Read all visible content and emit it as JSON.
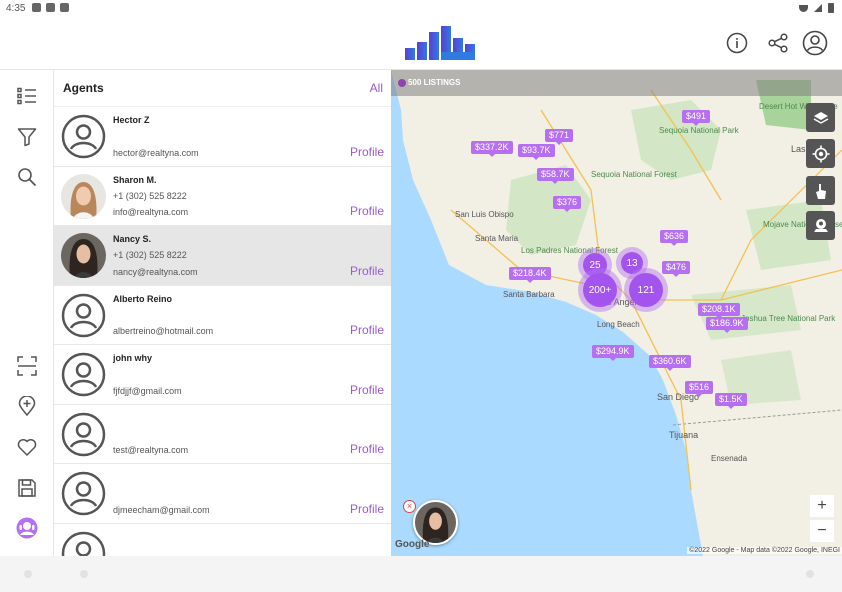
{
  "status_bar": {
    "time": "4:35"
  },
  "header": {
    "logo_icon": "bar-chart-logo",
    "buttons": [
      "info-icon",
      "share-icon",
      "account-icon"
    ]
  },
  "rail": {
    "top": [
      "list-icon",
      "filter-icon",
      "search-icon"
    ],
    "bottom": [
      "scan-icon",
      "add-location-icon",
      "heart-icon",
      "save-icon",
      "agent-icon"
    ]
  },
  "agents_panel": {
    "title": "Agents",
    "all_label": "All",
    "agents": [
      {
        "name": "Hector Z",
        "phone": "",
        "email": "hector@realtyna.com",
        "profile": "Profile",
        "photo": false,
        "selected": false
      },
      {
        "name": "Sharon M.",
        "phone": "+1 (302) 525 8222",
        "email": "info@realtyna.com",
        "profile": "Profile",
        "photo": true,
        "selected": false
      },
      {
        "name": "Nancy S.",
        "phone": "+1 (302) 525 8222",
        "email": "nancy@realtyna.com",
        "profile": "Profile",
        "photo": true,
        "selected": true
      },
      {
        "name": "Alberto Reino",
        "phone": "",
        "email": "albertreino@hotmail.com",
        "profile": "Profile",
        "photo": false,
        "selected": false
      },
      {
        "name": "john why",
        "phone": "",
        "email": "fjfdjjf@gmail.com",
        "profile": "Profile",
        "photo": false,
        "selected": false
      },
      {
        "name": "",
        "phone": "",
        "email": "test@realtyna.com",
        "profile": "Profile",
        "photo": false,
        "selected": false
      },
      {
        "name": "",
        "phone": "",
        "email": "djmeecham@gmail.com",
        "profile": "Profile",
        "photo": false,
        "selected": false
      },
      {
        "name": "",
        "phone": "",
        "email": "",
        "profile": "",
        "photo": false,
        "selected": false
      }
    ]
  },
  "map": {
    "listings_label": "500 LISTINGS",
    "accent": "#b56ff0",
    "price_pins": [
      "$491",
      "$771",
      "$337.2K",
      "$93.7K",
      "$58.7K",
      "$376",
      "$636",
      "$476",
      "$218.4K",
      "$208.1K",
      "$186.9K",
      "$294.9K",
      "$360.6K",
      "$516",
      "$1.5K"
    ],
    "clusters": [
      "25",
      "13",
      "200+",
      "121"
    ],
    "places": [
      "Desert Hot Wildlife Re",
      "Sequoia National Park",
      "Las Vegas",
      "Sequoia National Forest",
      "San Luis Obispo",
      "Santa Maria",
      "Los Padres National Forest",
      "Santa Barbara",
      "Los Angeles",
      "Long Beach",
      "Mojave National Preserve",
      "Joshua Tree National Park",
      "San Diego",
      "Tijuana",
      "Ensenada"
    ],
    "google_label": "Google",
    "attribution": "©2022 Google - Map data ©2022 Google, INEGI",
    "controls": [
      "layers-icon",
      "my-location-icon",
      "draw-hand-icon",
      "agent-pin-icon"
    ],
    "zoom_in": "+",
    "zoom_out": "−"
  }
}
